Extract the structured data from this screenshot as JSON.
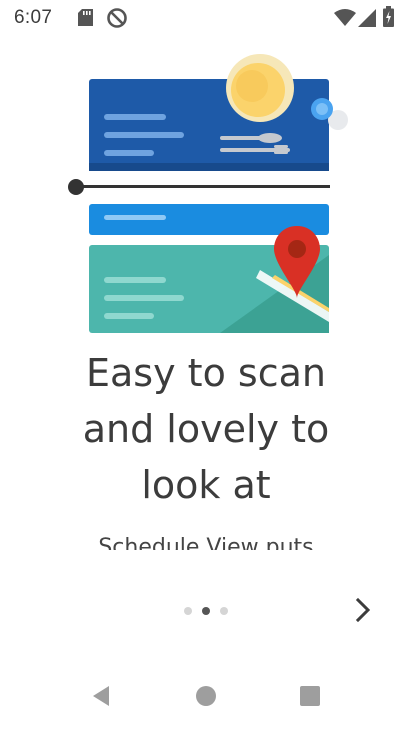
{
  "status_bar": {
    "time": "6:07",
    "icons": [
      "sd-card-icon",
      "blocked-icon",
      "wifi-icon",
      "cell-signal-icon",
      "battery-icon"
    ]
  },
  "onboarding": {
    "headline": "Easy to scan\nand lovely to\nlook at",
    "body": "Schedule View puts",
    "page_indicator": {
      "total": 3,
      "current": 2
    },
    "next_icon": "chevron-right-icon"
  },
  "nav_bar": {
    "buttons": [
      "back-icon",
      "home-icon",
      "recents-icon"
    ]
  },
  "colors": {
    "card_dark_blue": "#1e5aa8",
    "card_bright_blue": "#1a8ce0",
    "card_teal": "#4db6ac",
    "map_pin_red": "#d93025",
    "sun_yellow": "#fbd36b",
    "text": "#3c3c3c"
  }
}
